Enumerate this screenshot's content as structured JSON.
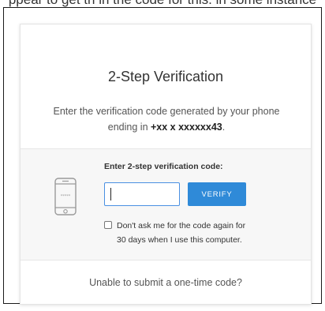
{
  "partial_header": "ppear to get th in the code for this. in some instance",
  "card": {
    "title": "2-Step Verification",
    "desc_prefix": "Enter the verification code generated by your phone ending in ",
    "desc_phone": "+xx x xxxxxx43",
    "desc_suffix": ".",
    "phone_icon": "smartphone-icon",
    "phone_screen_text": "*****",
    "code_label": "Enter 2-step verification code:",
    "code_value": "",
    "verify_label": "VERIFY",
    "remember_line1": "Don't ask me for the code again for",
    "remember_line2": "30 days when I use this computer.",
    "remember_checked": false,
    "unable_link": "Unable to submit a one-time code?"
  },
  "colors": {
    "accent": "#2f8ad8",
    "input_border": "#4a90e2",
    "panel_bg": "#f7f7f7"
  }
}
